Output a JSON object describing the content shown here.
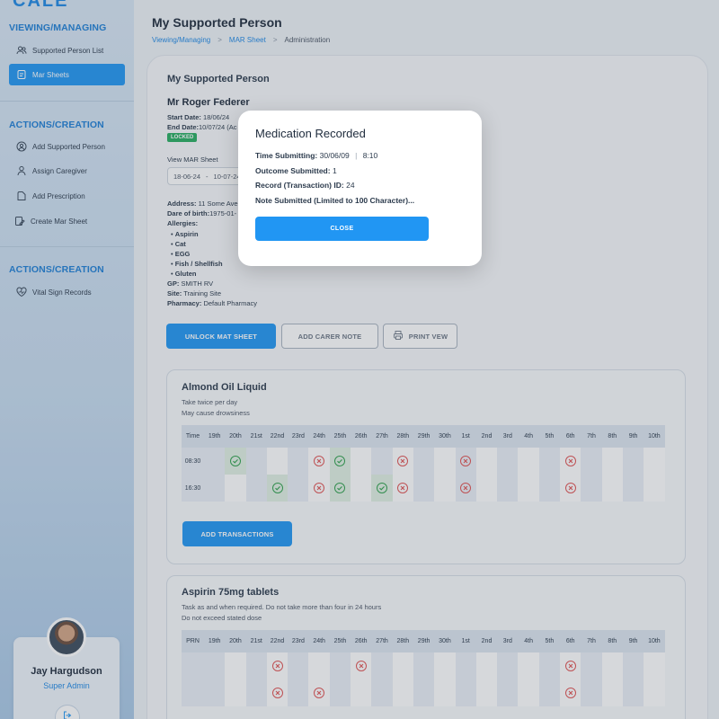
{
  "sidebar": {
    "logo": "CALE",
    "section1_title": "VIEWING/MANAGING",
    "section1_items": [
      {
        "label": "Supported Person List",
        "icon": "users-icon"
      },
      {
        "label": "Mar Sheets",
        "icon": "document-icon",
        "active": true
      }
    ],
    "section2_title": "ACTIONS/CREATION",
    "section2_items": [
      {
        "label": "Add Supported Person",
        "icon": "add-user-icon"
      },
      {
        "label": "Assign Caregiver",
        "icon": "person-icon"
      },
      {
        "label": "Add Prescription",
        "icon": "file-icon"
      },
      {
        "label": "Create Mar Sheet",
        "icon": "edit-icon"
      }
    ],
    "section3_title": "ACTIONS/CREATION",
    "section3_items": [
      {
        "label": "Vital Sign Records",
        "icon": "heartbeat-icon"
      }
    ],
    "profile": {
      "name": "Jay Hargudson",
      "role": "Super Admin"
    }
  },
  "header": {
    "title": "My Supported Person",
    "breadcrumb": [
      "Viewing/Managing",
      "MAR Sheet",
      "Administration"
    ]
  },
  "person": {
    "card_title": "My Supported Person",
    "name": "Mr Roger Federer",
    "start_date_label": "Start Date:",
    "start_date": "18/06/24",
    "end_date_label": "End Date:",
    "end_date": "10/07/24 (Ac",
    "status": "LOCKED",
    "view_mar_label": "View MAR Sheet",
    "date_range_start": "18-06-24",
    "date_range_end": "10-07-24",
    "address_label": "Address:",
    "address": "11 Some Ave",
    "dob_label": "Dare of birth:",
    "dob": "1975-01-",
    "allergies_label": "Allergies:",
    "allergies": [
      "Aspirin",
      "Cat",
      "EGG",
      "Fish / Shellfish",
      "Gluten"
    ],
    "gp_label": "GP:",
    "gp": "SMITH RV",
    "site_label": "Site:",
    "site": "Training Site",
    "pharmacy_label": "Pharmacy:",
    "pharmacy": "Default Pharmacy"
  },
  "actions": {
    "unlock": "UNLOCK MAT SHEET",
    "carer_note": "ADD CARER NOTE",
    "print": "PRINT VEW"
  },
  "medications": [
    {
      "name": "Almond Oil Liquid",
      "notes": [
        "Take twice per day",
        "May cause drowsiness"
      ],
      "first_col": "Time",
      "days": [
        "19th",
        "20th",
        "21st",
        "22nd",
        "23rd",
        "24th",
        "25th",
        "26th",
        "27th",
        "28th",
        "29th",
        "30th",
        "1st",
        "2nd",
        "3rd",
        "4th",
        "5th",
        "6th",
        "7th",
        "8th",
        "9th",
        "10th"
      ],
      "rows": [
        {
          "label": "08:30",
          "marks": [
            "",
            "ok",
            "",
            "",
            "",
            "x",
            "ok",
            "",
            "",
            "x",
            "",
            "",
            "x",
            "",
            "",
            "",
            "",
            "x",
            "",
            "",
            "",
            ""
          ]
        },
        {
          "label": "16:30",
          "marks": [
            "",
            "",
            "",
            "ok",
            "",
            "x",
            "ok",
            "",
            "ok",
            "x",
            "",
            "",
            "x",
            "",
            "",
            "",
            "",
            "x",
            "",
            "",
            "",
            ""
          ]
        }
      ],
      "button": "ADD TRANSACTIONS"
    },
    {
      "name": "Aspirin 75mg tablets",
      "notes": [
        "Task as and when required. Do not take more than four in 24 hours",
        "Do not exceed stated dose"
      ],
      "first_col": "PRN",
      "days": [
        "19th",
        "20th",
        "21st",
        "22nd",
        "23rd",
        "24th",
        "25th",
        "26th",
        "27th",
        "28th",
        "29th",
        "30th",
        "1st",
        "2nd",
        "3rd",
        "4th",
        "5th",
        "6th",
        "7th",
        "8th",
        "9th",
        "10th"
      ],
      "rows": [
        {
          "label": "",
          "marks": [
            "",
            "",
            "",
            "x",
            "",
            "",
            "",
            "x",
            "",
            "",
            "",
            "",
            "",
            "",
            "",
            "",
            "",
            "x",
            "",
            "",
            "",
            ""
          ]
        },
        {
          "label": "",
          "marks": [
            "",
            "",
            "",
            "x",
            "",
            "x",
            "",
            "",
            "",
            "",
            "",
            "",
            "",
            "",
            "",
            "",
            "",
            "x",
            "",
            "",
            "",
            ""
          ]
        }
      ]
    }
  ],
  "modal": {
    "title": "Medication Recorded",
    "time_label": "Time Submitting:",
    "time_date": "30/06/09",
    "time_sep": "|",
    "time_value": "8:10",
    "outcome_label": "Outcome Submitted:",
    "outcome_value": "1",
    "record_label": "Record (Transaction) ID:",
    "record_value": "24",
    "note_label": "Note Submitted (Limited to 100 Character)...",
    "close": "CLOSE"
  },
  "colors": {
    "accent": "#2196f3",
    "success": "#2fa04c",
    "danger": "#e05252",
    "locked_badge": "#27ae60"
  }
}
